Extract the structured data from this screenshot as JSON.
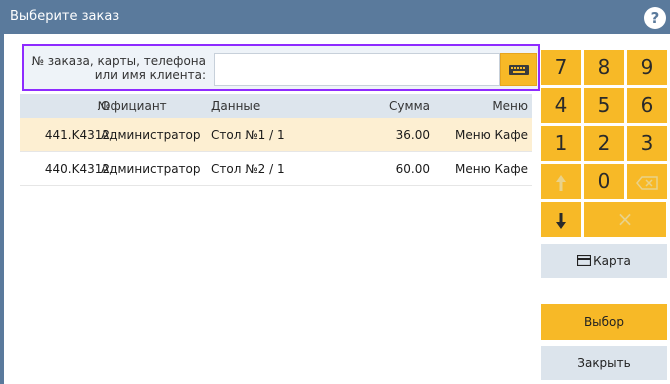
{
  "window": {
    "title": "Выберите заказ",
    "help_glyph": "?"
  },
  "search": {
    "label_line1": "№ заказа, карты, телефона",
    "label_line2": "или имя клиента:",
    "value": ""
  },
  "table": {
    "headers": {
      "num": "№",
      "waiter": "Официант",
      "data": "Данные",
      "sum": "Сумма",
      "menu": "Меню"
    },
    "rows": [
      {
        "num": "441.K4312",
        "waiter": "Администратор",
        "data": "Стол №1 / 1",
        "sum": "36.00",
        "menu": "Меню Кафе",
        "selected": true
      },
      {
        "num": "440.K4312",
        "waiter": "Администратор",
        "data": "Стол №2 / 1",
        "sum": "60.00",
        "menu": "Меню Кафе",
        "selected": false
      }
    ]
  },
  "keypad": {
    "k7": "7",
    "k8": "8",
    "k9": "9",
    "k4": "4",
    "k5": "5",
    "k6": "6",
    "k1": "1",
    "k2": "2",
    "k3": "3",
    "k0": "0",
    "clear": "×"
  },
  "buttons": {
    "card": "Карта",
    "select": "Выбор",
    "close": "Закрыть"
  },
  "colors": {
    "titlebar": "#5a7a9c",
    "accent": "#f7b927",
    "focus": "#8e2bff",
    "selected_row": "#fdefd2"
  }
}
